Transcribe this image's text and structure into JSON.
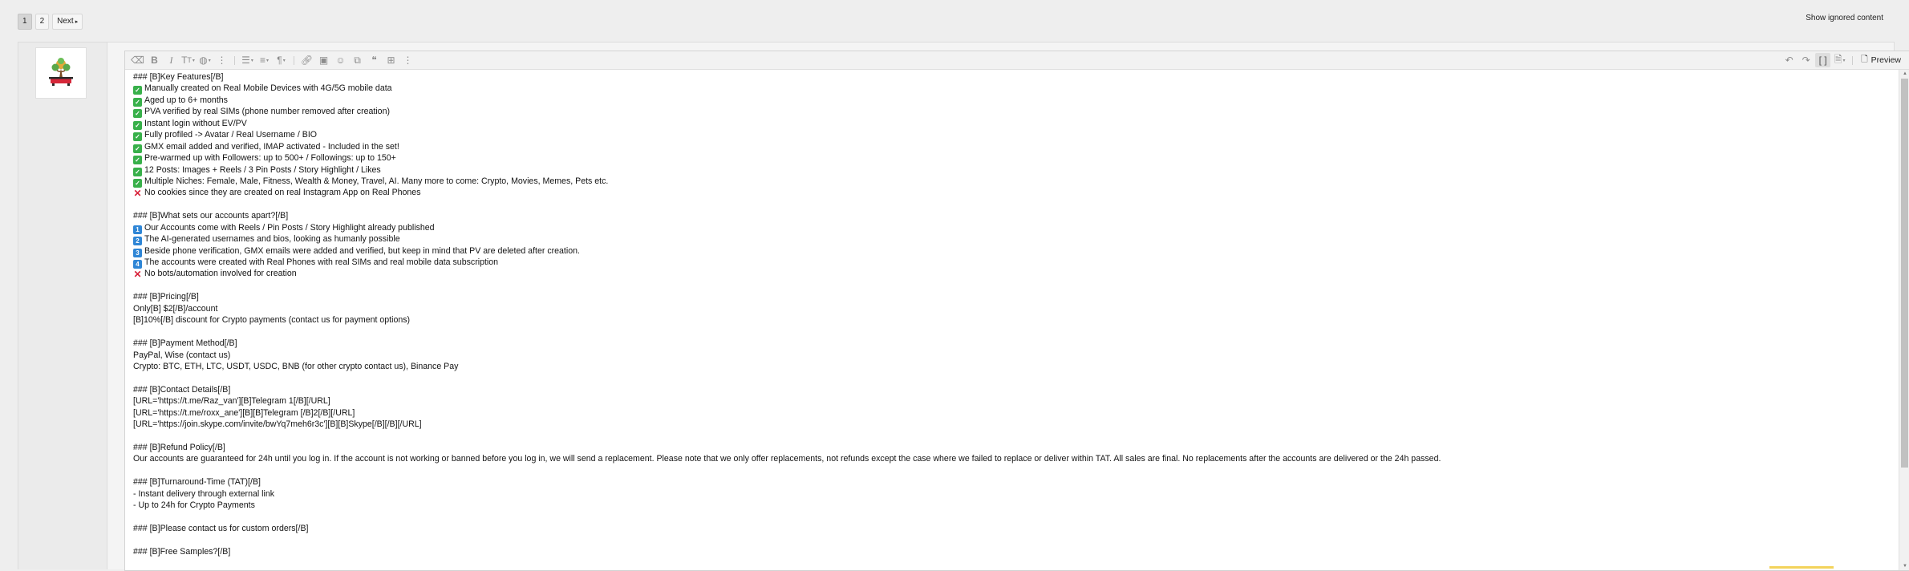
{
  "pagination": {
    "pages": [
      "1",
      "2"
    ],
    "current": "1",
    "next_label": "Next"
  },
  "show_ignored_label": "Show ignored content",
  "toolbar": {
    "left_icons": [
      "eraser-icon",
      "bold-icon",
      "italic-icon",
      "text-size-icon",
      "palette-icon",
      "more-options-icon",
      "list-icon",
      "align-icon",
      "paragraph-icon",
      "link-icon",
      "image-icon",
      "smilie-icon",
      "media-icon",
      "quote-icon",
      "table-icon",
      "more-insert-icon"
    ],
    "right_icons": [
      "undo-icon",
      "redo-icon",
      "bbcode-toggle-icon",
      "drafts-icon"
    ],
    "preview_label": "Preview"
  },
  "post": {
    "lines": [
      {
        "icon": "",
        "text": "### [B]Key Features[/B]"
      },
      {
        "icon": "check",
        "text": "Manually created on Real Mobile Devices with 4G/5G mobile data"
      },
      {
        "icon": "check",
        "text": "Aged up to 6+ months"
      },
      {
        "icon": "check",
        "text": "PVA verified by real SIMs (phone number removed after creation)"
      },
      {
        "icon": "check",
        "text": "Instant login without EV/PV"
      },
      {
        "icon": "check",
        "text": "Fully profiled -> Avatar / Real Username / BIO"
      },
      {
        "icon": "check",
        "text": "GMX email added and verified, IMAP activated - Included in the set!"
      },
      {
        "icon": "check",
        "text": "Pre-warmed up with Followers: up to 500+ / Followings: up to 150+"
      },
      {
        "icon": "check",
        "text": "12 Posts: Images + Reels / 3 Pin Posts / Story Highlight / Likes"
      },
      {
        "icon": "check",
        "text": "Multiple Niches: Female, Male, Fitness, Wealth & Money, Travel, AI. Many more to come: Crypto, Movies, Memes, Pets etc."
      },
      {
        "icon": "cross",
        "text": "No cookies since they are created on real Instagram App on Real Phones"
      },
      {
        "icon": "",
        "text": ""
      },
      {
        "icon": "",
        "text": "### [B]What sets our accounts apart?[/B]"
      },
      {
        "icon": "num",
        "num": "1",
        "text": "Our Accounts come with Reels / Pin Posts / Story Highlight already published"
      },
      {
        "icon": "num",
        "num": "2",
        "text": "The AI-generated usernames and bios, looking as humanly possible"
      },
      {
        "icon": "num",
        "num": "3",
        "text": "Beside phone verification, GMX emails were added and verified, but keep in mind that PV are deleted after creation."
      },
      {
        "icon": "num",
        "num": "4",
        "text": "The accounts were created with Real Phones with real SIMs and real mobile data subscription"
      },
      {
        "icon": "cross",
        "text": "No bots/automation involved for creation"
      },
      {
        "icon": "",
        "text": ""
      },
      {
        "icon": "",
        "text": "### [B]Pricing[/B]"
      },
      {
        "icon": "",
        "text": "Only[B] $2[/B]/account"
      },
      {
        "icon": "",
        "text": "[B]10%[/B] discount for Crypto payments (contact us for payment options)"
      },
      {
        "icon": "",
        "text": ""
      },
      {
        "icon": "",
        "text": "### [B]Payment Method[/B]"
      },
      {
        "icon": "",
        "text": "PayPal, Wise (contact us)"
      },
      {
        "icon": "",
        "text": "Crypto: BTC, ETH, LTC, USDT, USDC, BNB (for other crypto contact us), Binance Pay"
      },
      {
        "icon": "",
        "text": ""
      },
      {
        "icon": "",
        "text": "### [B]Contact Details[/B]"
      },
      {
        "icon": "",
        "text": "[URL='https://t.me/Raz_van'][B]Telegram 1[/B][/URL]"
      },
      {
        "icon": "",
        "text": "[URL='https://t.me/roxx_ane'][B][B]Telegram [/B]2[/B][/URL]"
      },
      {
        "icon": "",
        "text": "[URL='https://join.skype.com/invite/bwYq7meh6r3c'][B][B]Skype[/B][/B][/URL]"
      },
      {
        "icon": "",
        "text": ""
      },
      {
        "icon": "",
        "text": "### [B]Refund Policy[/B]"
      },
      {
        "icon": "",
        "text": "Our accounts are guaranteed for 24h until you log in. If the account is not working or banned before you log in, we will send a replacement. Please note that we only offer replacements, not refunds except the case where we failed to replace or deliver within TAT. All sales are final. No replacements after the accounts are delivered or the 24h passed."
      },
      {
        "icon": "",
        "text": ""
      },
      {
        "icon": "",
        "text": "### [B]Turnaround-Time (TAT)[/B]"
      },
      {
        "icon": "",
        "text": "- Instant delivery through external link"
      },
      {
        "icon": "",
        "text": "- Up to 24h for Crypto Payments"
      },
      {
        "icon": "",
        "text": ""
      },
      {
        "icon": "",
        "text": "### [B]Please contact us for custom orders[/B]"
      },
      {
        "icon": "",
        "text": ""
      },
      {
        "icon": "",
        "text": "### [B]Free Samples?[/B]"
      }
    ]
  }
}
